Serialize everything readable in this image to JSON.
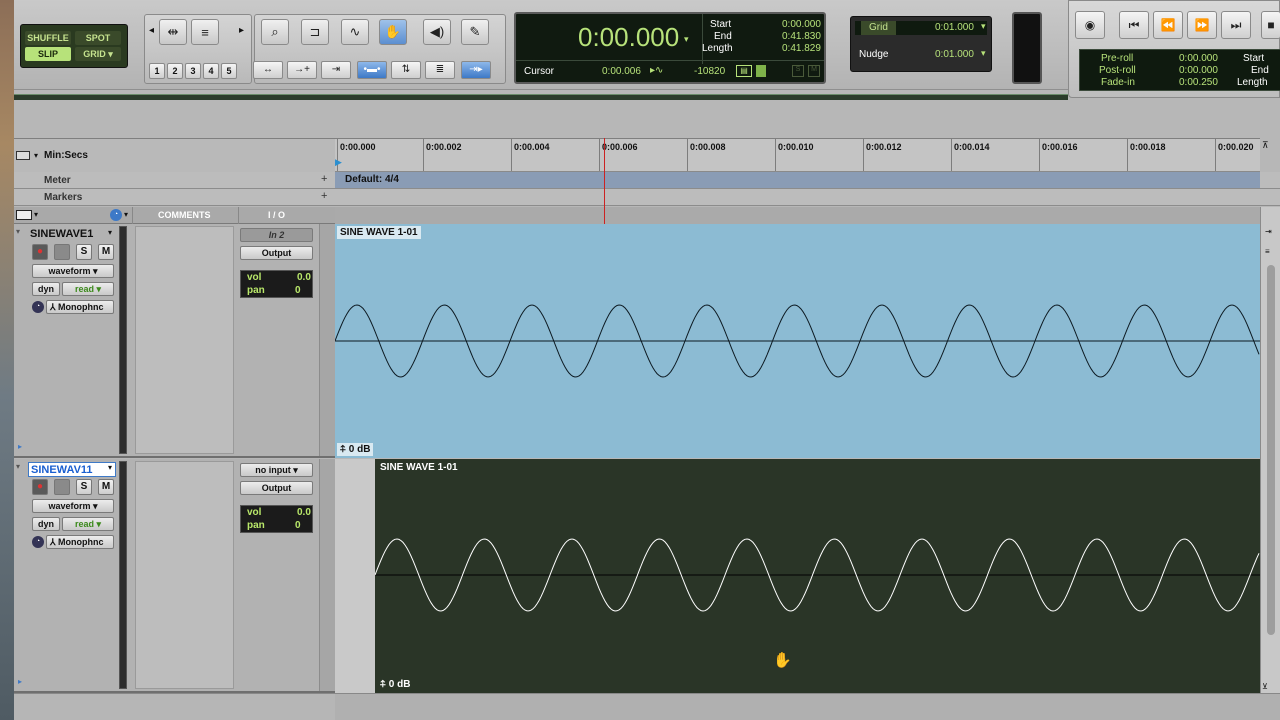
{
  "edit_modes": {
    "shuffle": "SHUFFLE",
    "spot": "SPOT",
    "slip": "SLIP",
    "grid": "GRID"
  },
  "zoom_presets": [
    "1",
    "2",
    "3",
    "4",
    "5"
  ],
  "counter": {
    "main": "0:00.000",
    "start_label": "Start",
    "end_label": "End",
    "length_label": "Length",
    "start": "0:00.000",
    "end": "0:41.830",
    "length": "0:41.829",
    "cursor_label": "Cursor",
    "cursor": "0:00.006",
    "sample_value": "-10820"
  },
  "grid_nudge": {
    "grid_label": "Grid",
    "grid_value": "0:01.000",
    "nudge_label": "Nudge",
    "nudge_value": "0:01.000"
  },
  "transport": {
    "preroll_label": "Pre-roll",
    "preroll": "0:00.000",
    "postroll_label": "Post-roll",
    "postroll": "0:00.000",
    "fadein_label": "Fade-in",
    "fadein": "0:00.250",
    "start_label": "Start",
    "end_label": "End",
    "length_label": "Length"
  },
  "rulers": {
    "main_ruler": "Min:Secs",
    "meter_label": "Meter",
    "markers_label": "Markers",
    "meter_value": "Default: 4/4",
    "ticks": [
      "0:00.002",
      "0:00.004",
      "0:00.006",
      "0:00.008",
      "0:00.010",
      "0:00.012",
      "0:00.014",
      "0:00.016",
      "0:00.018",
      "0:00.020"
    ],
    "first_tick": "0:00.000"
  },
  "columns": {
    "comments": "COMMENTS",
    "io": "I / O"
  },
  "tracks": [
    {
      "name": "SINEWAVE1",
      "view": "waveform",
      "dyn": "dyn",
      "automation": "read",
      "format": "Monophnc",
      "input": "In 2",
      "output": "Output",
      "vol_label": "vol",
      "vol": "0.0",
      "pan_label": "pan",
      "pan": "0",
      "solo": "S",
      "mute": "M",
      "clip_name": "SINE WAVE 1-01",
      "clip_gain": "0 dB",
      "selected": false,
      "clip_color": "#8cbbd3",
      "wave_color": "#0d1a22"
    },
    {
      "name": "SINEWAV11",
      "view": "waveform",
      "dyn": "dyn",
      "automation": "read",
      "format": "Monophnc",
      "input": "no input",
      "output": "Output",
      "vol_label": "vol",
      "vol": "0.0",
      "pan_label": "pan",
      "pan": "0",
      "solo": "S",
      "mute": "M",
      "clip_name": "SINE WAVE 1-01",
      "clip_gain": "0 dB",
      "selected": true,
      "clip_color": "#2a3527",
      "wave_color": "#ffffff"
    }
  ],
  "colors": {
    "accent_green": "#b7e27a",
    "selected_blue": "#3d79c7",
    "playhead": "#c22"
  }
}
